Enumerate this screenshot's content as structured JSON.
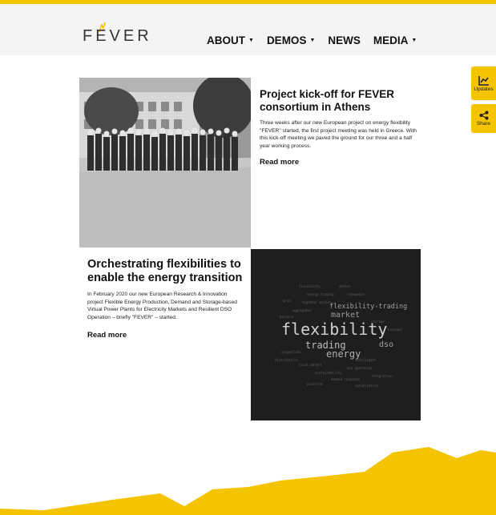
{
  "header": {
    "logo_text": "FEVER",
    "nav": [
      {
        "label": "ABOUT",
        "dropdown": true
      },
      {
        "label": "DEMOS",
        "dropdown": true
      },
      {
        "label": "NEWS",
        "dropdown": false
      },
      {
        "label": "MEDIA",
        "dropdown": true
      }
    ]
  },
  "side": {
    "updates_label": "Updates",
    "share_label": "Share"
  },
  "articles": [
    {
      "title": "Project kick-off for FEVER consortium in Athens",
      "text": "Three weeks after our new European project on energy flexibility \"FEVER\" started, the first project meeting was held in Greece. With this kick-off meeting we paved the ground for our three and a half year working process.",
      "read_more": "Read more"
    },
    {
      "title": "Orchestrating flexibilities to enable the energy transition",
      "text": "In February 2020 our new European Research & Innovation project Flexible Energy Production, Demand and Storage-based Virtual Power Plants for Electricity Markets and Resilient DSO Operation – briefly \"FEVER\" – started.",
      "read_more": "Read more"
    }
  ],
  "colors": {
    "accent": "#f5c400",
    "header_bg": "#f4f4f4",
    "cloud_bg": "#1e1e1e"
  }
}
